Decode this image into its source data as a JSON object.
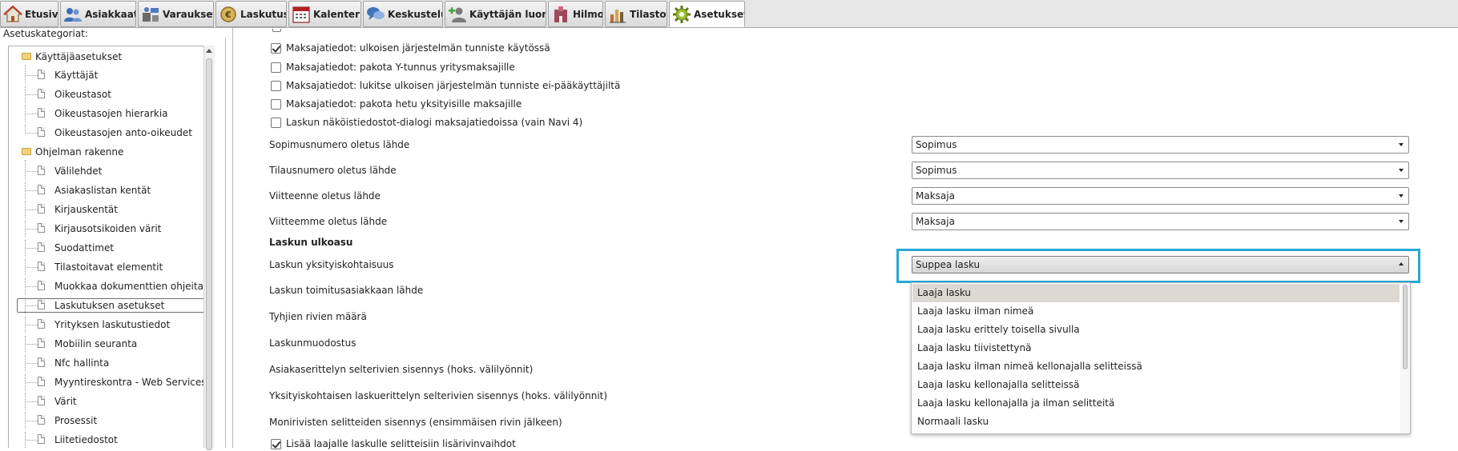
{
  "tabs": [
    {
      "id": "etusivu",
      "label": "Etusivu",
      "icon": "home-icon"
    },
    {
      "id": "asiakkaat",
      "label": "Asiakkaat",
      "icon": "customers-icon"
    },
    {
      "id": "varaukset",
      "label": "Varaukset",
      "icon": "reservations-icon"
    },
    {
      "id": "laskutus",
      "label": "Laskutus",
      "icon": "billing-coin-icon"
    },
    {
      "id": "kalenteri",
      "label": "Kalenteri",
      "icon": "calendar-icon"
    },
    {
      "id": "keskustelu",
      "label": "Keskustelu",
      "icon": "chat-bubbles-icon"
    },
    {
      "id": "kayttajan-luonti",
      "label": "Käyttäjän luonti",
      "icon": "add-user-icon"
    },
    {
      "id": "hilmo",
      "label": "Hilmo",
      "icon": "hospital-icon"
    },
    {
      "id": "tilastot",
      "label": "Tilastot",
      "icon": "bar-chart-icon"
    },
    {
      "id": "asetukset",
      "label": "Asetukset",
      "icon": "gear-icon",
      "active": true
    }
  ],
  "left_panel": {
    "header": "Asetuskategoriat:",
    "tree": [
      {
        "label": "Käyttäjäasetukset",
        "type": "folder"
      },
      {
        "label": "Käyttäjät",
        "type": "item"
      },
      {
        "label": "Oikeustasot",
        "type": "item"
      },
      {
        "label": "Oikeustasojen hierarkia",
        "type": "item"
      },
      {
        "label": "Oikeustasojen anto-oikeudet",
        "type": "item"
      },
      {
        "label": "Ohjelman rakenne",
        "type": "folder"
      },
      {
        "label": "Välilehdet",
        "type": "item"
      },
      {
        "label": "Asiakaslistan kentät",
        "type": "item"
      },
      {
        "label": "Kirjauskentät",
        "type": "item"
      },
      {
        "label": "Kirjausotsikoiden värit",
        "type": "item"
      },
      {
        "label": "Suodattimet",
        "type": "item"
      },
      {
        "label": "Tilastoitavat elementit",
        "type": "item"
      },
      {
        "label": "Muokkaa dokumenttien ohjeita",
        "type": "item"
      },
      {
        "label": "Laskutuksen asetukset",
        "type": "item",
        "selected": true
      },
      {
        "label": "Yrityksen laskutustiedot",
        "type": "item"
      },
      {
        "label": "Mobiilin seuranta",
        "type": "item"
      },
      {
        "label": "Nfc hallinta",
        "type": "item"
      },
      {
        "label": "Myyntireskontra - Web Services",
        "type": "item"
      },
      {
        "label": "Värit",
        "type": "item"
      },
      {
        "label": "Prosessit",
        "type": "item"
      },
      {
        "label": "Liitetiedostot",
        "type": "item"
      }
    ]
  },
  "settings": {
    "checkboxes": [
      {
        "label": "Maksajatiedot: ulkoisen järjestelmän tunniste käytössä",
        "checked": true
      },
      {
        "label": "Maksajatiedot: pakota Y-tunnus yritysmaksajille",
        "checked": false
      },
      {
        "label": "Maksajatiedot: lukitse ulkoisen järjestelmän tunniste ei-pääkäyttäjiltä",
        "checked": false
      },
      {
        "label": "Maksajatiedot: pakota hetu yksityisille maksajille",
        "checked": false
      },
      {
        "label": "Laskun näköistiedostot-dialogi maksajatiedoissa (vain Navi 4)",
        "checked": false
      }
    ],
    "fields": [
      {
        "label": "Sopimusnumero oletus lähde",
        "value": "Sopimus"
      },
      {
        "label": "Tilausnumero oletus lähde",
        "value": "Sopimus"
      },
      {
        "label": "Viitteenne oletus lähde",
        "value": "Maksaja"
      },
      {
        "label": "Viitteemme oletus lähde",
        "value": "Maksaja"
      }
    ],
    "section_title": "Laskun ulkoasu",
    "open_field": {
      "label": "Laskun yksityiskohtaisuus",
      "value": "Suppea lasku"
    },
    "more_labels": [
      "Laskun toimitusasiakkaan lähde",
      "Tyhjien rivien määrä",
      "Laskunmuodostus",
      "Asiakaserittelyn selterivien sisennys (hoks. välilyönnit)",
      "Yksityiskohtaisen laskuerittelyn selterivien sisennys (hoks. välilyönnit)",
      "Monirivisten selitteiden sisennys (ensimmäisen rivin jälkeen)"
    ],
    "last_checkbox": {
      "label": "Lisää laajalle laskulle selitteisiin lisärivinvaihdot",
      "checked": true
    }
  },
  "dropdown_options": [
    {
      "label": "Laaja lasku",
      "highlighted": true
    },
    {
      "label": "Laaja lasku ilman nimeä"
    },
    {
      "label": "Laaja lasku erittely toisella sivulla"
    },
    {
      "label": "Laaja lasku tiivistettynä"
    },
    {
      "label": "Laaja lasku ilman nimeä kellonajalla selitteissä"
    },
    {
      "label": "Laaja lasku kellonajalla selitteissä"
    },
    {
      "label": "Laaja lasku kellonajalla ja ilman selitteitä"
    },
    {
      "label": "Normaali lasku"
    }
  ],
  "colors": {
    "focus_highlight": "#25a8d6",
    "option_highlight": "#dcd9d2"
  }
}
